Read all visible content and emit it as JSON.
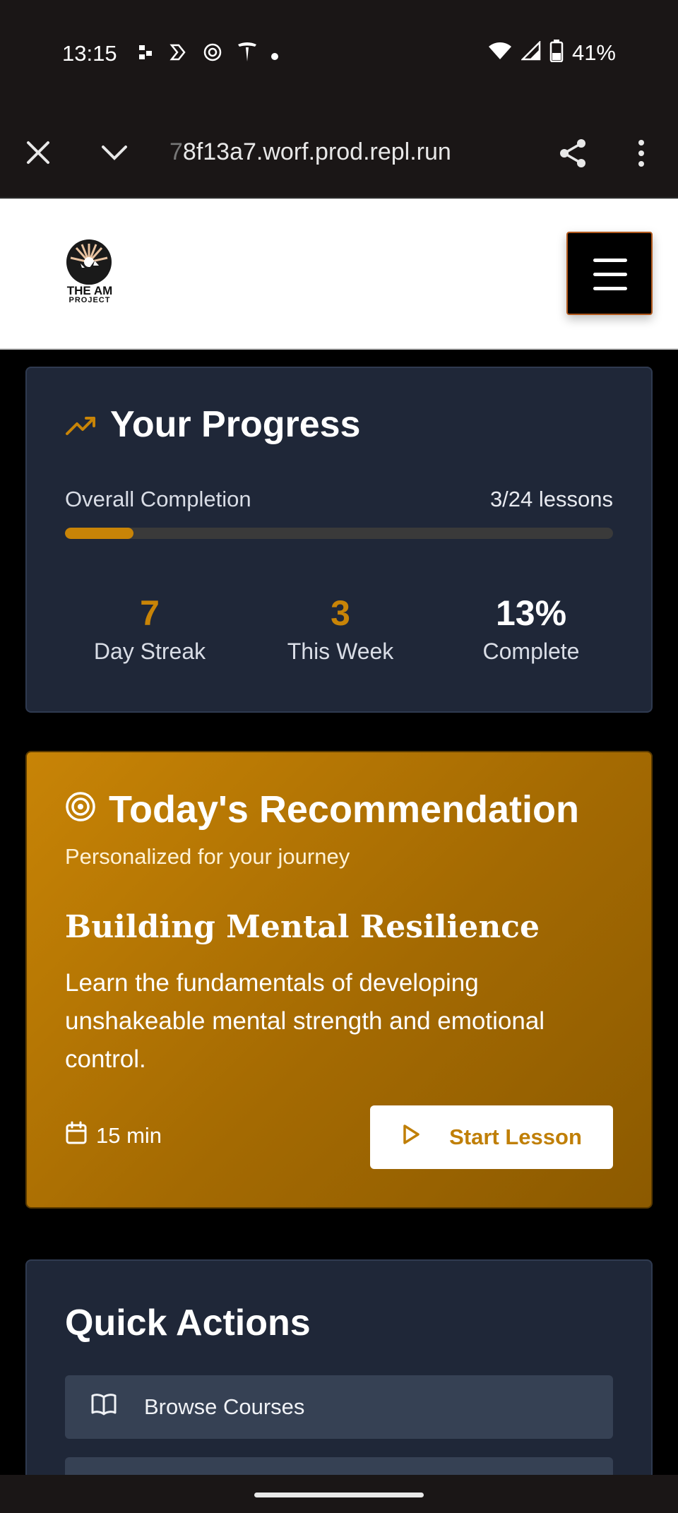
{
  "status_bar": {
    "time": "13:15",
    "battery": "41%",
    "left_icons": [
      "tasks-icon",
      "copilot-icon",
      "openai-icon",
      "tesla-icon",
      "dot-icon"
    ],
    "right_icons": [
      "wifi-icon",
      "signal-icon",
      "battery-icon"
    ]
  },
  "browser": {
    "url_faded": "7",
    "url": "8f13a7.worf.prod.repl.run"
  },
  "header": {
    "logo_line1": "THE AM",
    "logo_line2": "PROJECT"
  },
  "progress": {
    "title": "Your Progress",
    "completion_label": "Overall Completion",
    "completion_value": "3/24 lessons",
    "completion_fraction": 0.125,
    "stats": [
      {
        "value": "7",
        "label": "Day Streak",
        "color": "#c88407"
      },
      {
        "value": "3",
        "label": "This Week",
        "color": "#c88407"
      },
      {
        "value": "13%",
        "label": "Complete",
        "color": "#ffffff"
      }
    ]
  },
  "recommendation": {
    "title": "Today's Recommendation",
    "subtitle": "Personalized for your journey",
    "lesson_title": "Building Mental Resilience",
    "description": "Learn the fundamentals of developing unshakeable mental strength and emotional control.",
    "duration": "15 min",
    "button": "Start Lesson"
  },
  "quick_actions": {
    "title": "Quick Actions",
    "items": [
      {
        "label": "Browse Courses",
        "icon": "book-icon"
      },
      {
        "label": "",
        "icon": ""
      }
    ]
  },
  "colors": {
    "accent": "#c88407",
    "card_bg": "#1f2738",
    "page_bg": "#000000"
  }
}
